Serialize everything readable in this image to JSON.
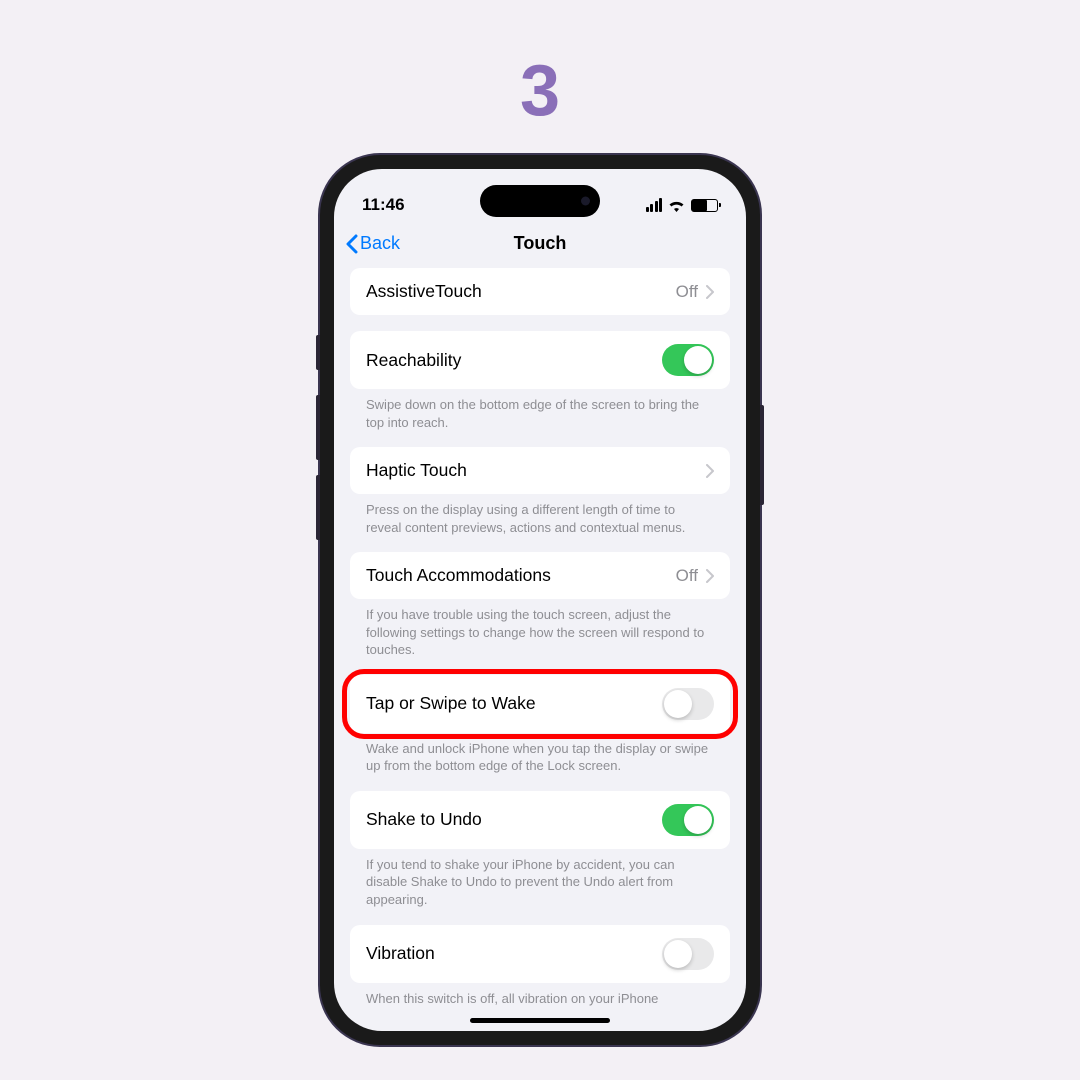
{
  "step": "3",
  "statusBar": {
    "time": "11:46"
  },
  "nav": {
    "back": "Back",
    "title": "Touch"
  },
  "rows": {
    "assistiveTouch": {
      "label": "AssistiveTouch",
      "value": "Off"
    },
    "reachability": {
      "label": "Reachability",
      "footer": "Swipe down on the bottom edge of the screen to bring the top into reach."
    },
    "hapticTouch": {
      "label": "Haptic Touch",
      "footer": "Press on the display using a different length of time to reveal content previews, actions and contextual menus."
    },
    "touchAccommodations": {
      "label": "Touch Accommodations",
      "value": "Off",
      "footer": "If you have trouble using the touch screen, adjust the following settings to change how the screen will respond to touches."
    },
    "tapSwipeWake": {
      "label": "Tap or Swipe to Wake",
      "footer": "Wake and unlock iPhone when you tap the display or swipe up from the bottom edge of the Lock screen."
    },
    "shakeUndo": {
      "label": "Shake to Undo",
      "footer": "If you tend to shake your iPhone by accident, you can disable Shake to Undo to prevent the Undo alert from appearing."
    },
    "vibration": {
      "label": "Vibration",
      "footer": "When this switch is off, all vibration on your iPhone"
    }
  }
}
